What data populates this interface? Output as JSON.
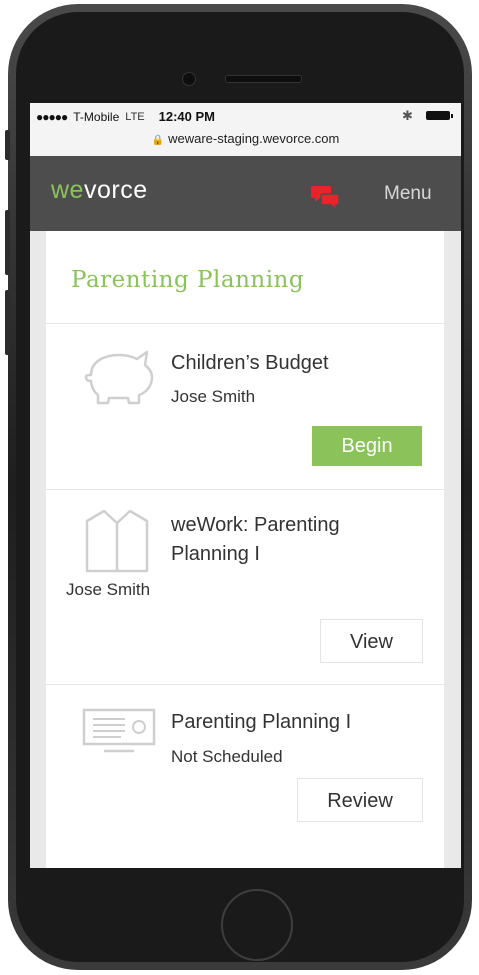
{
  "status_bar": {
    "signal": "●●●●●",
    "carrier": "T-Mobile",
    "network": "LTE",
    "time": "12:40 PM",
    "bluetooth": "✱",
    "url": "weware-staging.wevorce.com"
  },
  "navbar": {
    "logo_we": "we",
    "logo_rest": "vorce",
    "menu_label": "Menu"
  },
  "section": {
    "title": "Parenting Planning"
  },
  "items": [
    {
      "title": "Children’s Budget",
      "subtitle": "Jose Smith",
      "button": "Begin",
      "icon": "piggy-bank-icon"
    },
    {
      "title_line1": "weWork: Parenting",
      "title_line2": "Planning I",
      "subtitle": "Jose Smith",
      "button": "View",
      "icon": "open-book-icon"
    },
    {
      "title": "Parenting Planning I",
      "subtitle": "Not Scheduled",
      "button": "Review",
      "icon": "projector-screen-icon"
    }
  ],
  "colors": {
    "accent": "#8bc35a",
    "navbar": "#4d4d4d",
    "chat_icon": "#e8232a"
  }
}
